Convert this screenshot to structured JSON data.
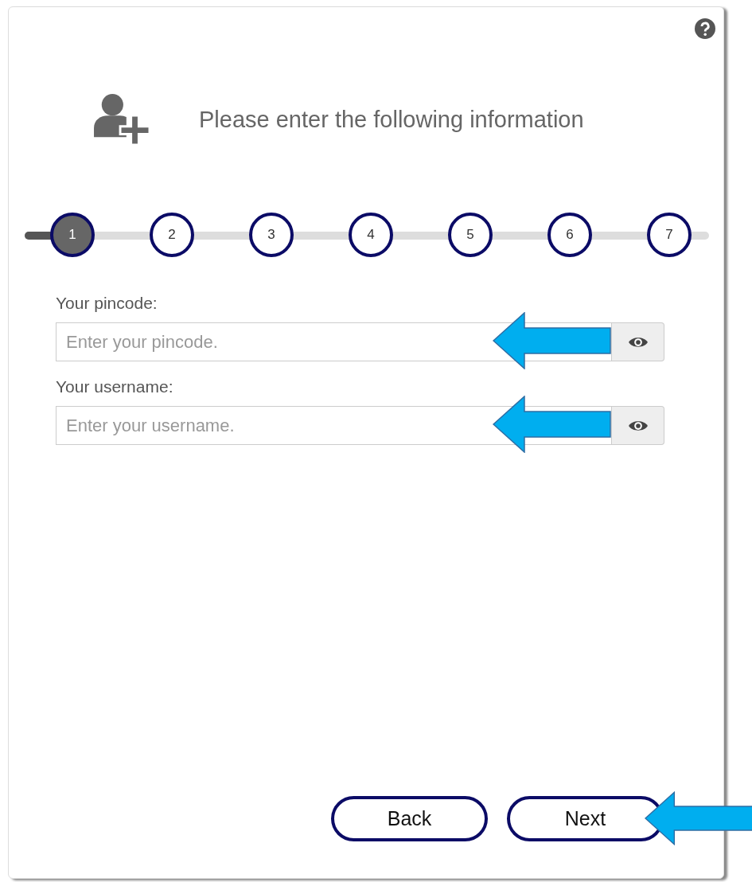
{
  "help": {
    "visible": true
  },
  "header": {
    "title": "Please enter the following information"
  },
  "steps": [
    {
      "label": "1",
      "selected": true
    },
    {
      "label": "2",
      "selected": false
    },
    {
      "label": "3",
      "selected": false
    },
    {
      "label": "4",
      "selected": false
    },
    {
      "label": "5",
      "selected": false
    },
    {
      "label": "6",
      "selected": false
    },
    {
      "label": "7",
      "selected": false
    }
  ],
  "fields": [
    {
      "label": "Your pincode:",
      "placeholder": "Enter your pincode.",
      "highlighted": true
    },
    {
      "label": "Your username:",
      "placeholder": "Enter your username.",
      "highlighted": true
    }
  ],
  "buttons": [
    {
      "label": "Back",
      "highlighted": false
    },
    {
      "label": "Next",
      "highlighted": true
    }
  ]
}
